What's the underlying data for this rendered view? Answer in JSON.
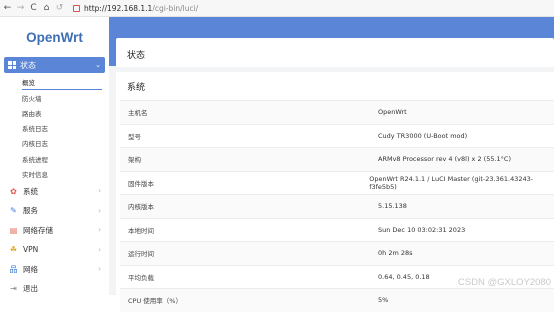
{
  "browser": {
    "back": "←",
    "forward": "→",
    "reload": "C",
    "home": "⌂",
    "undo": "↺",
    "url_host": "http://192.168.1.1",
    "url_path": "/cgi-bin/luci/"
  },
  "brand": {
    "logo_text": "OpenWrt",
    "accent": "#5b85d6"
  },
  "sidebar": {
    "active_menu": {
      "label": "状态",
      "icon": "grid-icon"
    },
    "subitems": [
      "概览",
      "防火墙",
      "路由表",
      "系统日志",
      "内核日志",
      "系统进程",
      "实时信息"
    ],
    "menu": [
      {
        "label": "系统",
        "icon": "gear-icon"
      },
      {
        "label": "服务",
        "icon": "service-icon"
      },
      {
        "label": "网络存储",
        "icon": "storage-icon"
      },
      {
        "label": "VPN",
        "icon": "vpn-icon"
      },
      {
        "label": "网络",
        "icon": "network-icon"
      },
      {
        "label": "退出",
        "icon": "logout-icon"
      }
    ]
  },
  "main": {
    "page_title": "状态",
    "section_title": "系统",
    "rows": [
      {
        "key": "主机名",
        "value": "OpenWrt"
      },
      {
        "key": "型号",
        "value": "Cudy TR3000 (U-Boot mod)"
      },
      {
        "key": "架构",
        "value": "ARMv8 Processor rev 4 (v8l) x 2 (55.1°C)"
      },
      {
        "key": "固件版本",
        "value": "OpenWrt R24.1.1 / LuCI Master (git-23.361.43243-f3fe5b5)"
      },
      {
        "key": "内核版本",
        "value": "5.15.138"
      },
      {
        "key": "本地时间",
        "value": "Sun Dec 10 03:02:31 2023"
      },
      {
        "key": "运行时间",
        "value": "0h 2m 28s"
      },
      {
        "key": "平均负载",
        "value": "0.64, 0.45, 0.18"
      },
      {
        "key": "CPU 使用率（%）",
        "value": "5%"
      }
    ]
  },
  "watermark": "CSDN @GXLOY2080"
}
